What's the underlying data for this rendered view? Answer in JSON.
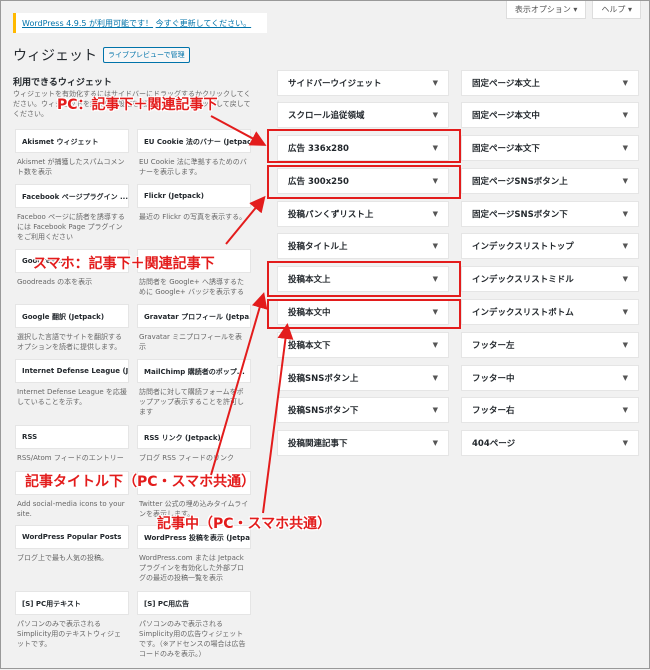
{
  "header": {
    "screen_options": "表示オプション ▾",
    "help": "ヘルプ ▾"
  },
  "notice": {
    "text": "WordPress 4.9.5 が利用可能です！",
    "link": "今すぐ更新してください。"
  },
  "page": {
    "title": "ウィジェット",
    "live_preview": "ライブプレビューで管理"
  },
  "available": {
    "title": "利用できるウィジェット",
    "description": "ウィジェットを有効化するにはサイドバーにドラッグするかクリックしてください。ウィジェットを無効化し設定を削除するには、ドラッグして戻してください。"
  },
  "widgets": [
    {
      "name": "Akismet ウィジェット",
      "desc": "Akismet が捕獲したスパムコメント数を表示"
    },
    {
      "name": "EU Cookie 法のバナー (Jetpack)",
      "desc": "EU Cookie 法に準拠するためのバナーを表示します。"
    },
    {
      "name": "Facebook ページプラグイン ...",
      "desc": "Faceboo ページに読者を誘導するには Facebook Page プラグインをご利用ください"
    },
    {
      "name": "Flickr (Jetpack)",
      "desc": "最近の Flickr の写真を表示する。"
    },
    {
      "name": "Goodreads",
      "desc": "Goodreads の本を表示"
    },
    {
      "name": "Google+",
      "desc": "訪問者を Google+ へ誘導するために Google+ バッジを表示する"
    },
    {
      "name": "Google 翻訳 (Jetpack)",
      "desc": "選択した言語でサイトを翻訳するオプションを読者に提供します。"
    },
    {
      "name": "Gravatar プロフィール (Jetpa...",
      "desc": "Gravatar ミニプロフィールを表示"
    },
    {
      "name": "Internet Defense League (Jet...",
      "desc": "Internet Defense League を応援していることを示す。"
    },
    {
      "name": "MailChimp 購読者のポップ...",
      "desc": "訪問者に対して購読フォームをポップアップ表示することを許可します"
    },
    {
      "name": "RSS",
      "desc": "RSS/Atom フィードのエントリー"
    },
    {
      "name": "RSS リンク (Jetpack)",
      "desc": "ブログ RSS フィードのリンク"
    },
    {
      "name": "",
      "desc": "Add social-media icons to your site."
    },
    {
      "name": "",
      "desc": "Twitter 公式の埋め込みタイムラインを表示します。"
    },
    {
      "name": "WordPress Popular Posts",
      "desc": "ブログ上で最も人気の投稿。"
    },
    {
      "name": "WordPress 投稿を表示 (Jetpa...",
      "desc": "WordPress.com または Jetpack プラグインを有効化した外部ブログの最近の投稿一覧を表示"
    },
    {
      "name": "[S] PC用テキスト",
      "desc": "パソコンのみで表示されるSimplicity用のテキストウィジェットです。"
    },
    {
      "name": "[S] PC用広告",
      "desc": "パソコンのみで表示されるSimplicity用の広告ウィジェットです。（※アドセンスの場合は広告コードのみを表示。）"
    }
  ],
  "areas_left": [
    "サイドバーウイジェット",
    "スクロール追従領域",
    "広告 336x280",
    "広告 300x250",
    "投稿パンくずリスト上",
    "投稿タイトル上",
    "投稿本文上",
    "投稿本文中",
    "投稿本文下",
    "投稿SNSボタン上",
    "投稿SNSボタン下",
    "投稿関連記事下"
  ],
  "areas_right": [
    "固定ページ本文上",
    "固定ページ本文中",
    "固定ページ本文下",
    "固定ページSNSボタン上",
    "固定ページSNSボタン下",
    "インデックスリストトップ",
    "インデックスリストミドル",
    "インデックスリストボトム",
    "フッター左",
    "フッター中",
    "フッター右",
    "404ページ"
  ],
  "annotations": {
    "pc": "PC：記事下＋関連記事下",
    "sp": "スマホ：記事下＋関連記事下",
    "title_below": "記事タイトル下（PC・スマホ共通）",
    "mid": "記事中（PC・スマホ共通）"
  },
  "colors": {
    "annotation": "#e31c1c",
    "notice_border": "#ffb900",
    "link": "#0073aa"
  }
}
